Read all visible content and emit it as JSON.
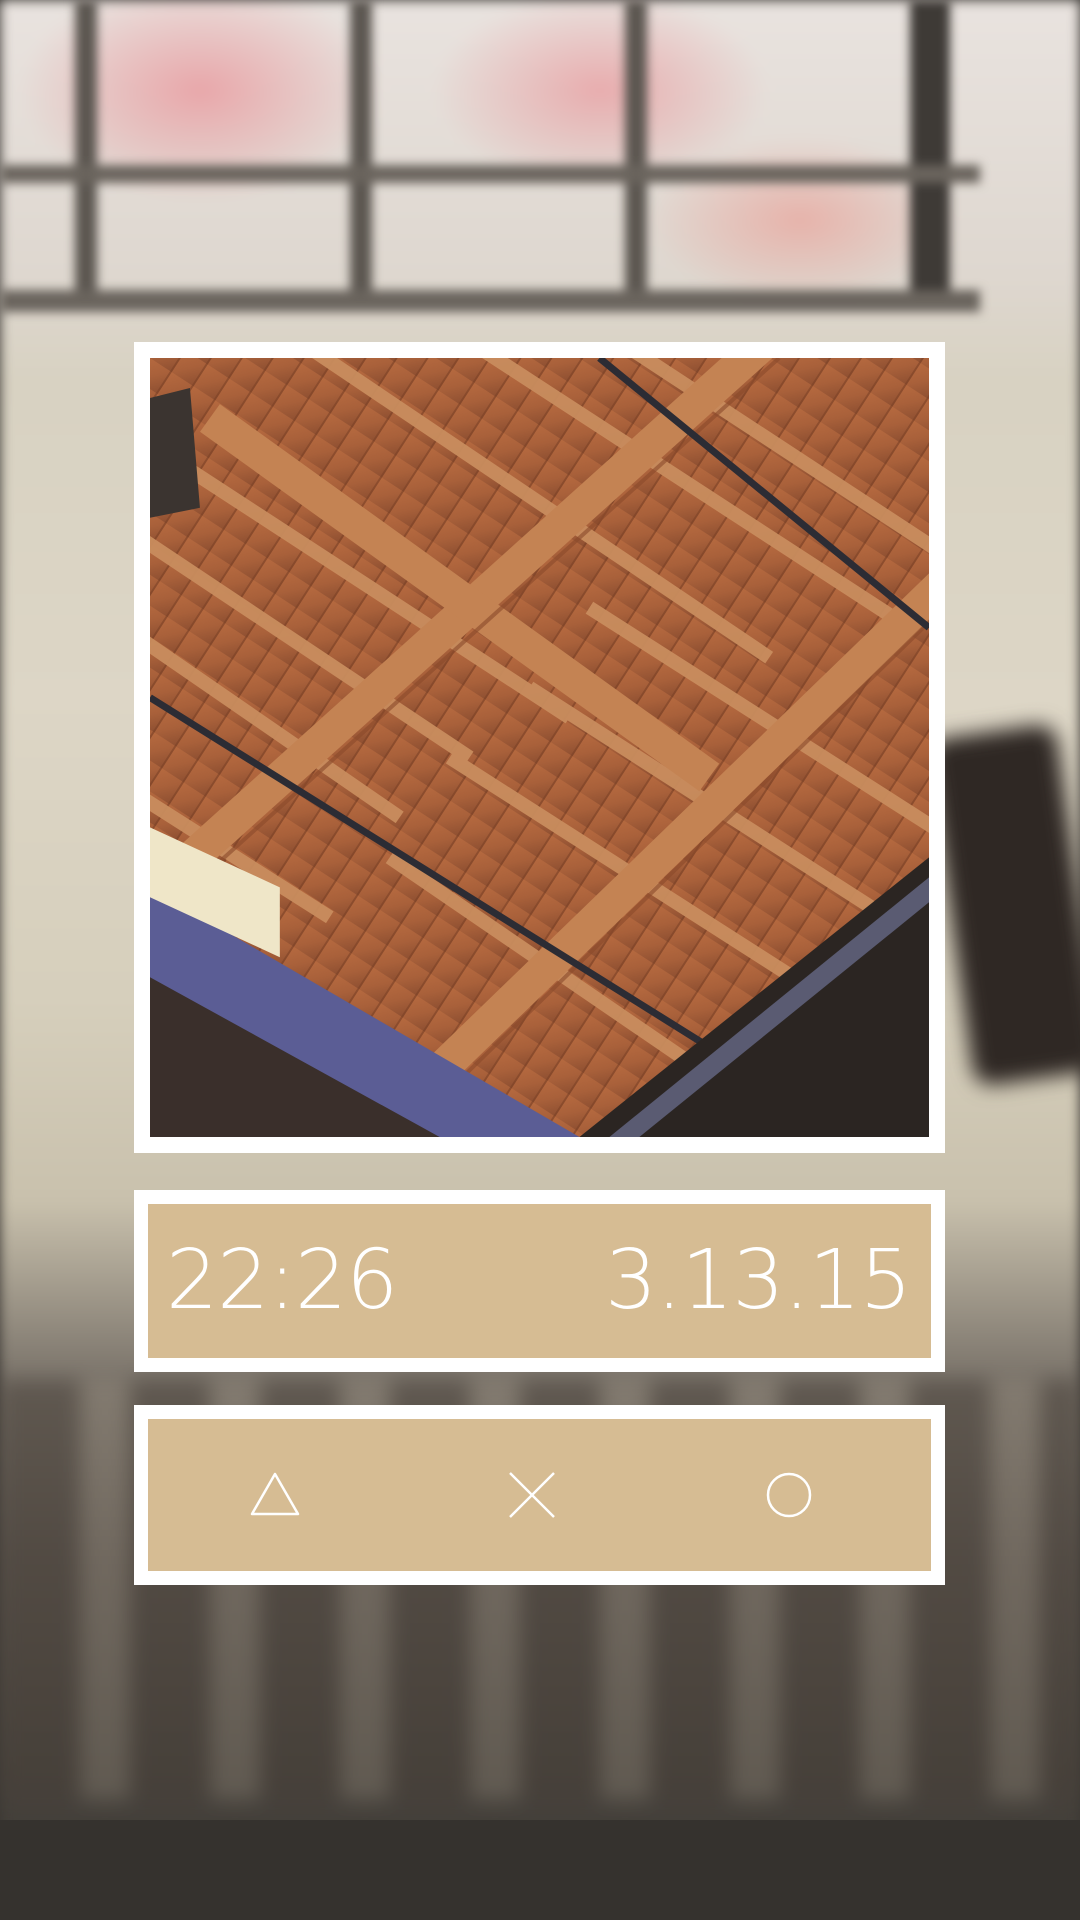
{
  "lockscreen": {
    "time": "22:26",
    "date": "3.13.15"
  },
  "photo": {
    "subject": "wooden-ceiling-photo"
  },
  "actions": [
    {
      "icon": "triangle-icon"
    },
    {
      "icon": "cross-icon"
    },
    {
      "icon": "circle-icon"
    }
  ],
  "colors": {
    "panel": "#d6bc93",
    "frame": "#ffffff",
    "text": "#ffffff"
  }
}
